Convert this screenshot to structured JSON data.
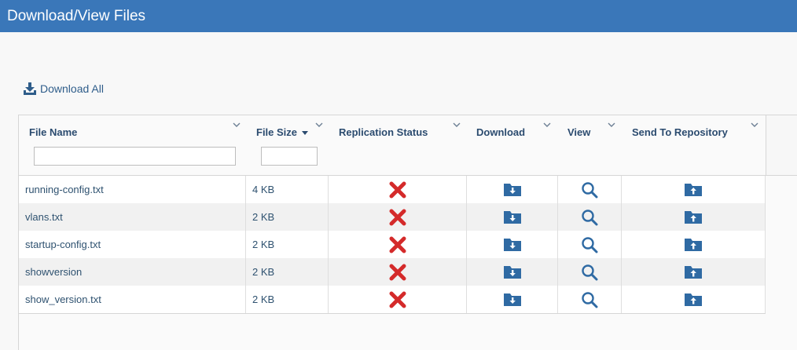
{
  "window": {
    "title": "Download/View Files"
  },
  "toolbar": {
    "download_all_label": "Download All",
    "download_all_icon": "download-tray-icon"
  },
  "table": {
    "columns": [
      {
        "key": "file_name",
        "label": "File Name",
        "has_filter": true
      },
      {
        "key": "file_size",
        "label": "File Size",
        "has_filter": true,
        "sorted": "descending"
      },
      {
        "key": "replication_status",
        "label": "Replication Status"
      },
      {
        "key": "download",
        "label": "Download"
      },
      {
        "key": "view",
        "label": "View"
      },
      {
        "key": "send_to_repository",
        "label": "Send To Repository"
      }
    ],
    "filters": {
      "file_name": "",
      "file_size": ""
    },
    "rows": [
      {
        "file_name": "running-config.txt",
        "file_size": "4 KB",
        "replication_status": "failed"
      },
      {
        "file_name": "vlans.txt",
        "file_size": "2 KB",
        "replication_status": "failed"
      },
      {
        "file_name": "startup-config.txt",
        "file_size": "2 KB",
        "replication_status": "failed"
      },
      {
        "file_name": "showversion",
        "file_size": "2 KB",
        "replication_status": "failed"
      },
      {
        "file_name": "show_version.txt",
        "file_size": "2 KB",
        "replication_status": "failed"
      }
    ],
    "icons": {
      "replication_status": "red-x-icon",
      "download": "folder-download-icon",
      "view": "magnifier-icon",
      "send_to_repository": "folder-upload-icon"
    }
  },
  "colors": {
    "title_bar": "#3a77b9",
    "icon_blue": "#2f6aa3",
    "status_error": "#d42a2a"
  }
}
